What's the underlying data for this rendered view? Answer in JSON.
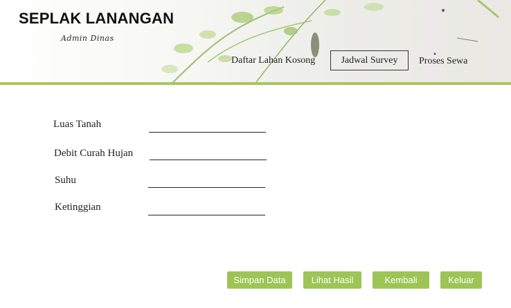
{
  "header": {
    "title": "SEPLAK LANANGAN",
    "subtitle": "Admin Dinas"
  },
  "nav": {
    "items": [
      {
        "label": "Daftar Lahan Kosong"
      },
      {
        "label": "Jadwal Survey"
      },
      {
        "label": "Proses Sewa"
      }
    ],
    "active": "Jadwal Survey"
  },
  "form": {
    "fields": [
      {
        "label": "Luas Tanah",
        "value": ""
      },
      {
        "label": "Debit Curah Hujan",
        "value": ""
      },
      {
        "label": "Suhu",
        "value": ""
      },
      {
        "label": "Ketinggian",
        "value": ""
      }
    ]
  },
  "buttons": {
    "save": "Simpan Data",
    "view_result": "Lihat Hasil",
    "back": "Kembali",
    "exit": "Keluar"
  },
  "colors": {
    "accent": "#9dc455",
    "rule": "#a8c65a"
  }
}
